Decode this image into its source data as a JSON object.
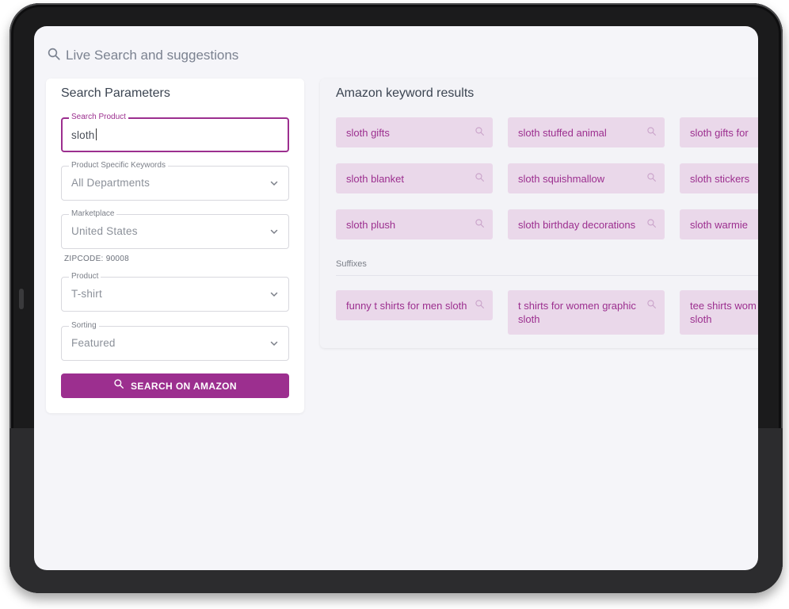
{
  "header": {
    "title": "Live Search and suggestions",
    "icon": "search-icon"
  },
  "params": {
    "title": "Search Parameters",
    "search_product": {
      "label": "Search Product",
      "value": "sloth"
    },
    "keywords": {
      "label": "Product Specific Keywords",
      "value": "All Departments"
    },
    "marketplace": {
      "label": "Marketplace",
      "value": "United States"
    },
    "zipcode": "ZIPCODE: 90008",
    "product": {
      "label": "Product",
      "value": "T-shirt"
    },
    "sorting": {
      "label": "Sorting",
      "value": "Featured"
    },
    "button_label": "SEARCH ON AMAZON"
  },
  "results": {
    "title": "Amazon keyword results",
    "keywords": [
      "sloth gifts",
      "sloth stuffed animal",
      "sloth gifts for",
      "sloth blanket",
      "sloth squishmallow",
      "sloth stickers",
      "sloth plush",
      "sloth birthday decorations",
      "sloth warmie"
    ],
    "suffixes_label": "Suffixes",
    "suffixes": [
      "funny t shirts for men sloth",
      "t shirts for women graphic sloth",
      "tee shirts wom sloth"
    ]
  },
  "colors": {
    "accent": "#9c2f8f",
    "chip_bg": "#ead8ea",
    "screen_bg": "#f5f5f9"
  }
}
